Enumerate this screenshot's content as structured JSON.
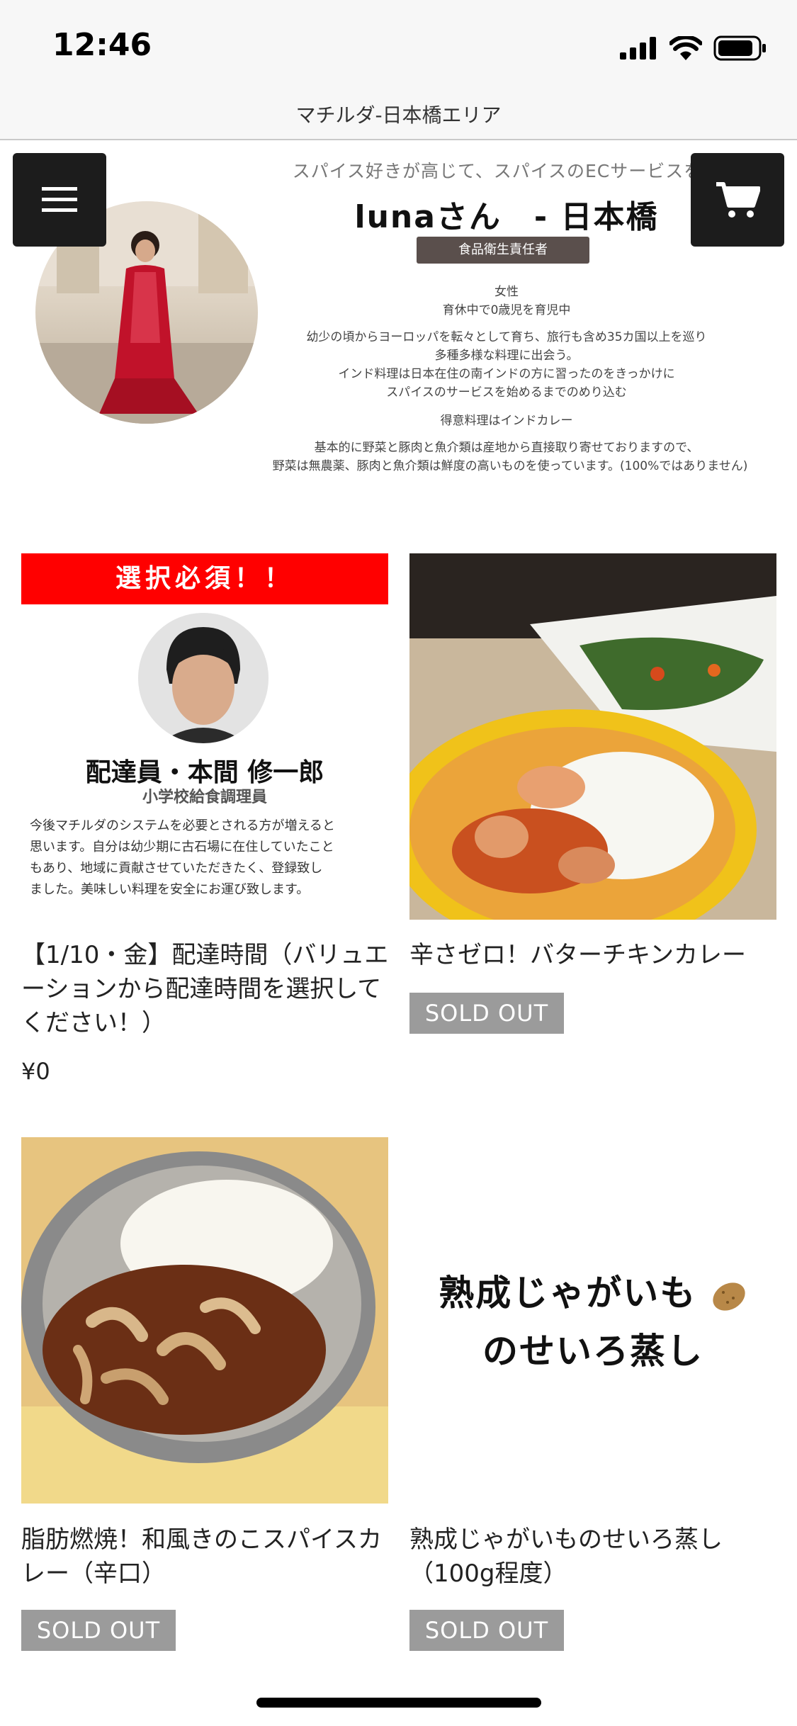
{
  "status_bar": {
    "time": "12:46"
  },
  "header": {
    "site_title": "マチルダ-日本橋エリア"
  },
  "banner": {
    "tagline": "スパイス好きが高じて、スパイスのECサービスを運",
    "chef_name": "lunaさん　- 日本橋",
    "role_badge": "食品衛生責任者",
    "gender": "女性",
    "status": "育休中で0歳児を育児中",
    "bio_line1": "幼少の頃からヨーロッパを転々として育ち、旅行も含め35カ国以上を巡り",
    "bio_line2": "多種多様な料理に出会う。",
    "bio_line3": "インド料理は日本在住の南インドの方に習ったのをきっかけに",
    "bio_line4": "スパイスのサービスを始めるまでのめり込む",
    "specialty": "得意料理はインドカレー",
    "sourcing_line1": "基本的に野菜と豚肉と魚介類は産地から直接取り寄せておりますので、",
    "sourcing_line2": "野菜は無農薬、豚肉と魚介類は鮮度の高いものを使っています。(100%ではありません)"
  },
  "colors": {
    "required_red": "#ff0000",
    "sold_out_gray": "#9b9b9b",
    "header_btn": "#1c1c1c"
  },
  "products": [
    {
      "image": {
        "required_banner": "選択必須！！",
        "courier_name": "配達員・本間 修一郎",
        "courier_role": "小学校給食調理員",
        "message_line1": "今後マチルダのシステムを必要とされる方が増えると",
        "message_line2": "思います。自分は幼少期に古石場に在住していたこと",
        "message_line3": "もあり、地域に貢献させていただきたく、登録致し",
        "message_line4": "ました。美味しい料理を安全にお運び致します。"
      },
      "title": "【1/10・金】配達時間（バリュエーションから配達時間を選択してください！）",
      "price": "¥0"
    },
    {
      "title": "辛さゼロ！バターチキンカレー",
      "status": "SOLD OUT"
    },
    {
      "title": "脂肪燃焼！和風きのこスパイスカレー（辛口）",
      "status": "SOLD OUT"
    },
    {
      "image": {
        "line1": "熟成じゃがいも",
        "line2": "のせいろ蒸し"
      },
      "title": "熟成じゃがいものせいろ蒸し（100g程度）",
      "status": "SOLD OUT"
    }
  ]
}
